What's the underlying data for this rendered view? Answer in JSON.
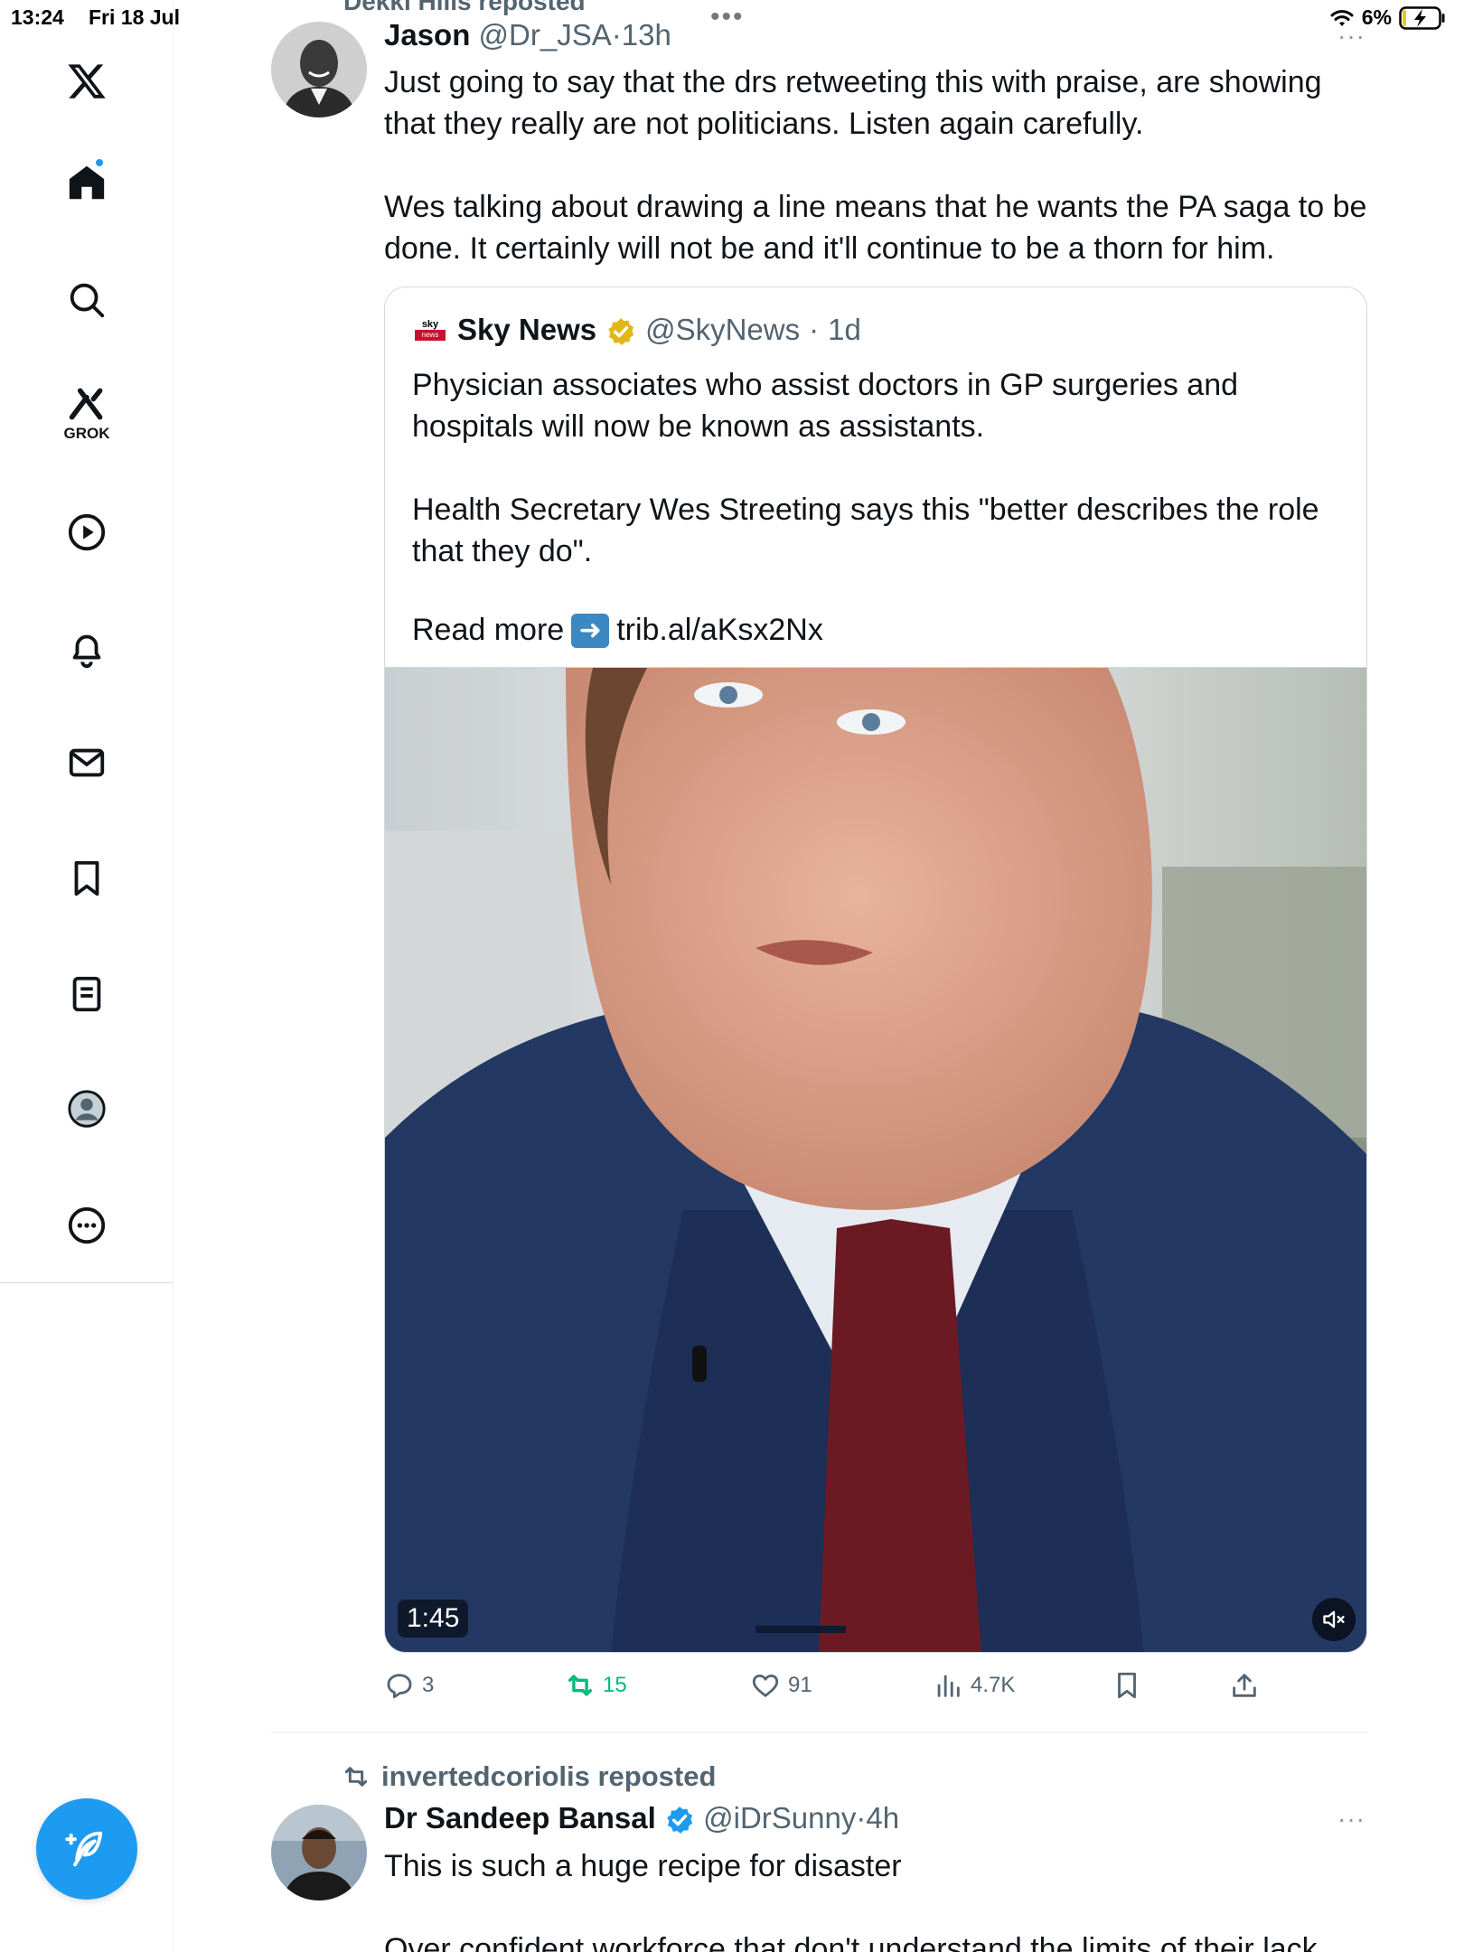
{
  "status_bar": {
    "time": "13:24",
    "date": "Fri 18 Jul",
    "battery": "6%"
  },
  "sidebar": {
    "items": [
      {
        "name": "x-logo",
        "label": ""
      },
      {
        "name": "home",
        "label": ""
      },
      {
        "name": "search",
        "label": ""
      },
      {
        "name": "grok",
        "label": "GROK"
      },
      {
        "name": "video",
        "label": ""
      },
      {
        "name": "notifications",
        "label": ""
      },
      {
        "name": "messages",
        "label": ""
      },
      {
        "name": "bookmarks",
        "label": ""
      },
      {
        "name": "lists",
        "label": ""
      },
      {
        "name": "profile",
        "label": ""
      },
      {
        "name": "more",
        "label": ""
      }
    ],
    "compose_icon": "compose-feather-icon"
  },
  "feed": {
    "prev_repost_label": "Dekki Hills reposted",
    "tweet1": {
      "name": "Jason",
      "handle": "@Dr_JSA",
      "separator": "·",
      "time": "13h",
      "text": "Just going to say that the drs retweeting this with praise, are showing that they really are not politicians. Listen again carefully.\n\nWes talking about drawing a line means that he wants the PA saga to be done. It certainly will not be and it'll continue to be a thorn for him.",
      "quote": {
        "name": "Sky News",
        "handle": "@SkyNews",
        "separator": "·",
        "time": "1d",
        "text": "Physician associates who assist doctors in GP surgeries and hospitals will now be known as assistants.\n\nHealth Secretary Wes Streeting says this \"better describes the role that they do\".",
        "read_more": "Read more",
        "link": "trib.al/aKsx2Nx",
        "video_duration": "1:45",
        "logo_top": "sky",
        "logo_bottom": "news"
      },
      "stats": {
        "replies": "3",
        "reposts": "15",
        "likes": "91",
        "views": "4.7K"
      }
    },
    "tweet2": {
      "repost_label": "invertedcoriolis reposted",
      "name": "Dr Sandeep Bansal",
      "handle": "@iDrSunny",
      "separator": "·",
      "time": "4h",
      "text": "This is such a huge recipe for disaster\n\nOver confident workforce that don't understand the limits of their lack"
    }
  },
  "colors": {
    "accent": "#1d9bf0",
    "repost_green": "#00ba7c",
    "secondary_text": "#536471",
    "verified_gold": "#e2b719"
  }
}
